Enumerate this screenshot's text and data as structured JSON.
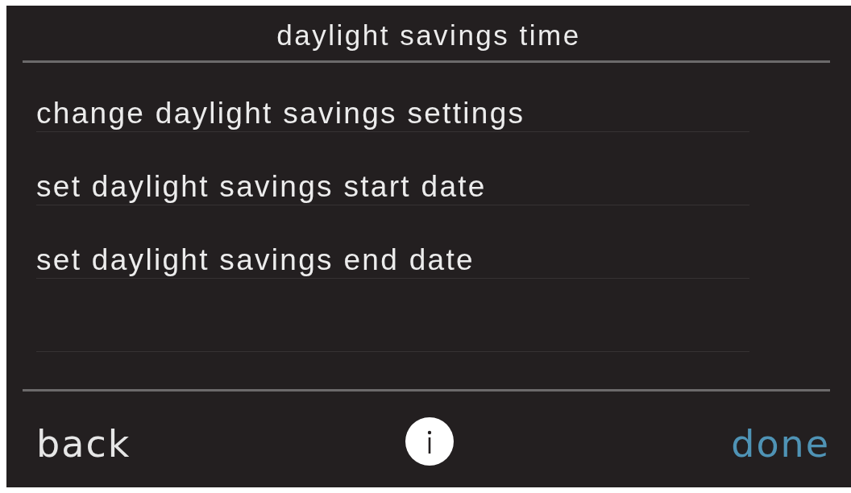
{
  "screen": {
    "title": "daylight savings time"
  },
  "menu": {
    "items": [
      {
        "label": "change daylight savings settings"
      },
      {
        "label": "set daylight savings start date"
      },
      {
        "label": "set daylight savings end date"
      }
    ]
  },
  "footer": {
    "back": {
      "label": "back"
    },
    "done": {
      "label": "done"
    }
  }
}
